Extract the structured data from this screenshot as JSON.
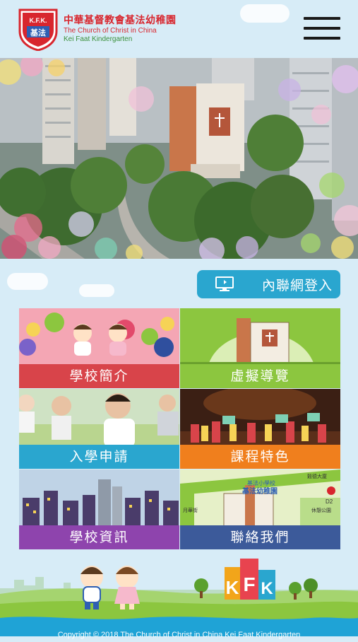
{
  "header": {
    "logo_badge_letters": "K.F.K.",
    "logo_badge_zh": "基法",
    "school_name_zh": "中華基督教會基法幼稚園",
    "school_name_en_1": "The Church of Christ in China",
    "school_name_en_2": "Kei Faat Kindergarten"
  },
  "intranet": {
    "label": "內聯網登入",
    "icon": "monitor-icon"
  },
  "tiles": [
    {
      "label": "學校簡介",
      "color": "#d8444a"
    },
    {
      "label": "虛擬導覽",
      "color": "#8cc63f"
    },
    {
      "label": "入學申請",
      "color": "#2aa6cf"
    },
    {
      "label": "課程特色",
      "color": "#f07f1d"
    },
    {
      "label": "學校資訊",
      "color": "#8e44ad"
    },
    {
      "label": "聯絡我們",
      "color": "#3c5a9a"
    }
  ],
  "map_labels": {
    "school_small": "基法小學校",
    "school_big": "基法幼稚園",
    "road_top": "穀德大廈",
    "park": "休憩公園",
    "code": "D2",
    "road_side": "月華街"
  },
  "footer": {
    "mascot_letters": [
      "K",
      "F",
      "K"
    ],
    "copyright": "Copyright © 2018 The Church of Christ in China Kei Faat Kindergarten"
  }
}
